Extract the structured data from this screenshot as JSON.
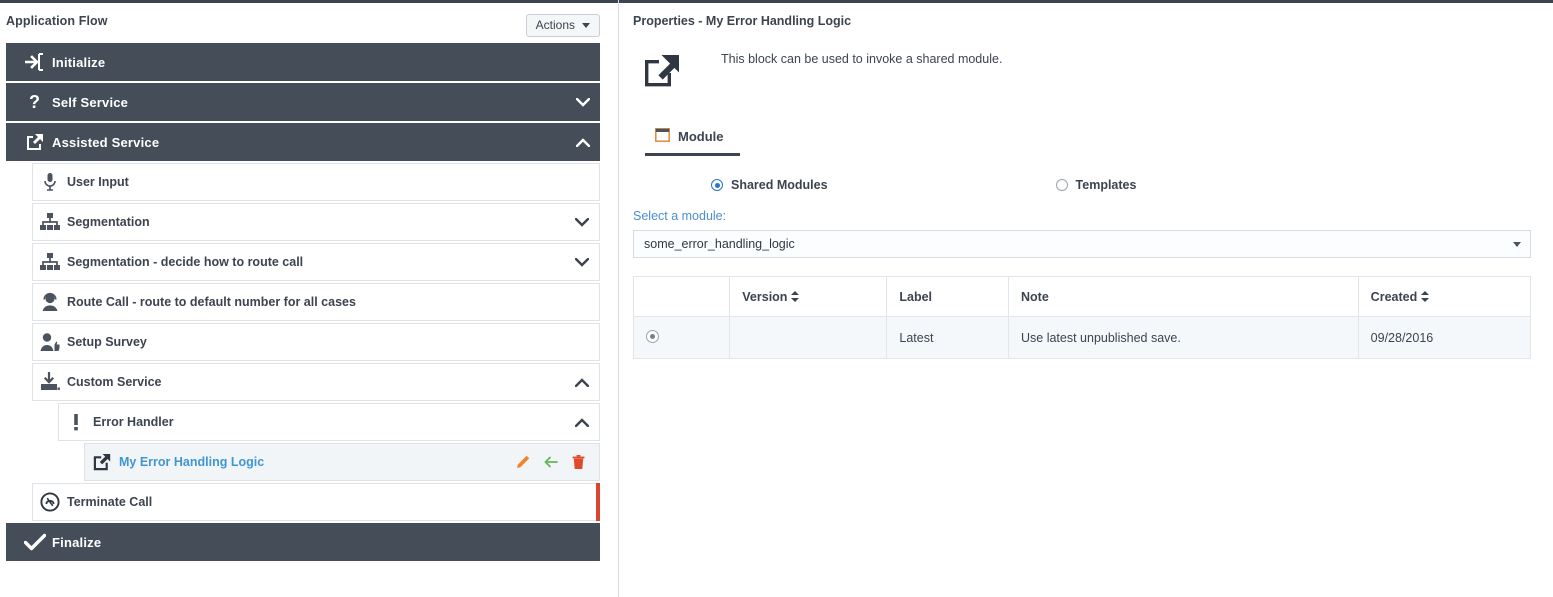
{
  "top_rule_color": "#3c4450",
  "left_panel": {
    "title": "Application Flow",
    "actions_button": "Actions",
    "nodes": [
      {
        "label": "Initialize",
        "icon": "sign-in-icon",
        "style": "dark",
        "indent": 0,
        "chevron": ""
      },
      {
        "label": "Self Service",
        "icon": "question-mark-icon",
        "style": "dark",
        "indent": 0,
        "chevron": "down"
      },
      {
        "label": "Assisted Service",
        "icon": "share-box-icon",
        "style": "dark",
        "indent": 0,
        "chevron": "up"
      },
      {
        "label": "User Input",
        "icon": "microphone-icon",
        "style": "light",
        "indent": 1,
        "chevron": ""
      },
      {
        "label": "Segmentation",
        "icon": "sitemap-icon",
        "style": "light",
        "indent": 1,
        "chevron": "down"
      },
      {
        "label": "Segmentation - decide how to route call",
        "icon": "sitemap-icon",
        "style": "light",
        "indent": 1,
        "chevron": "down"
      },
      {
        "label": "Route Call - route to default number for all cases",
        "icon": "headset-agent-icon",
        "style": "light",
        "indent": 1,
        "chevron": ""
      },
      {
        "label": "Setup Survey",
        "icon": "user-thumbsup-icon",
        "style": "light",
        "indent": 1,
        "chevron": ""
      },
      {
        "label": "Custom Service",
        "icon": "inbox-download-icon",
        "style": "light",
        "indent": 1,
        "chevron": "up"
      },
      {
        "label": "Error Handler",
        "icon": "exclamation-icon",
        "style": "light",
        "indent": 2,
        "chevron": "up"
      },
      {
        "label": "My Error Handling Logic",
        "icon": "external-link-icon",
        "style": "selected",
        "indent": 3,
        "chevron": ""
      },
      {
        "label": "Terminate Call",
        "icon": "end-call-icon",
        "style": "light",
        "indent": 1,
        "chevron": "",
        "right_edge": "#d9452e"
      },
      {
        "label": "Finalize",
        "icon": "check-icon",
        "style": "dark",
        "indent": 0,
        "chevron": ""
      }
    ],
    "row_action_icons": [
      {
        "name": "edit-pencil-icon",
        "color": "#f0842a"
      },
      {
        "name": "go-to-arrow-icon",
        "color": "#68b558"
      },
      {
        "name": "delete-trash-icon",
        "color": "#e04a2b"
      }
    ]
  },
  "right_panel": {
    "title": "Properties - My Error Handling Logic",
    "block_icon": "external-link-icon",
    "block_description": "This block can be used to invoke a shared module.",
    "tabs": [
      {
        "label": "Module",
        "icon": "window-panel-icon",
        "active": true
      }
    ],
    "radios": [
      {
        "label": "Shared Modules",
        "checked": true
      },
      {
        "label": "Templates",
        "checked": false
      }
    ],
    "select": {
      "label": "Select a module:",
      "value": "some_error_handling_logic",
      "caret": "chevron-down-icon"
    },
    "table": {
      "columns": [
        {
          "key": "select",
          "label": "",
          "sortable": false
        },
        {
          "key": "version",
          "label": "Version",
          "sortable": true
        },
        {
          "key": "label",
          "label": "Label",
          "sortable": false
        },
        {
          "key": "note",
          "label": "Note",
          "sortable": false
        },
        {
          "key": "created",
          "label": "Created",
          "sortable": true
        }
      ],
      "rows": [
        {
          "selected": true,
          "version": "",
          "label": "Latest",
          "note": "Use latest unpublished save.",
          "created": "09/28/2016"
        }
      ]
    }
  },
  "colors": {
    "dark_node": "#454d59",
    "selected_text": "#3f96d1",
    "link_label": "#4a8fd0",
    "radio_accent": "#2a74c9",
    "red_edge": "#d9452e"
  }
}
